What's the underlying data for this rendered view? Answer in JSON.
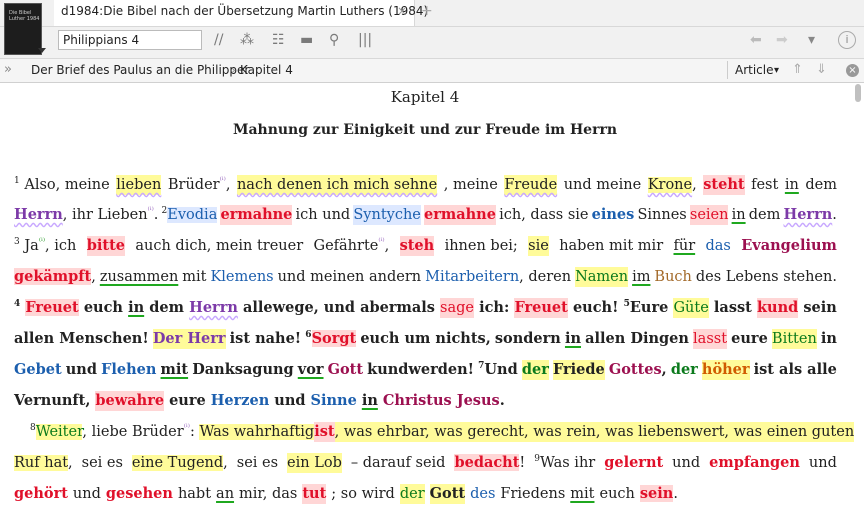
{
  "tab": {
    "title": "d1984:Die Bibel nach der Übersetzung Martin Luthers (1984)",
    "close_icon": "×",
    "add_icon": "+"
  },
  "toolbar": {
    "reference_value": "Philippians 4",
    "icons": [
      "parallel-icon",
      "group-icon",
      "list-icon",
      "panel-icon",
      "search-icon",
      "columns-icon"
    ],
    "nav": {
      "back": "⬅",
      "forward": "➡",
      "menu": "▾",
      "info": "i"
    }
  },
  "crumb": {
    "expand": "»",
    "book": "Der Brief des Paulus an die Philipper",
    "sep": "›",
    "chapter": "Kapitel 4",
    "view": "Article",
    "view_caret": "▾"
  },
  "content": {
    "chapter_title": "Kapitel 4",
    "heading": "Mahnung zur Einigkeit und zur Freude im Herrn",
    "line1": [
      "1",
      "Also, meine",
      "lieben",
      "Brüder",
      ",",
      "nach denen ich mich sehne",
      ", meine",
      "Freude",
      "und meine",
      "Krone",
      ",",
      "steht",
      "fest",
      "in",
      "dem"
    ],
    "line2": [
      "Herrn",
      ", ihr Lieben",
      ".",
      "2",
      "Evodia",
      "ermahne",
      "ich und",
      "Syntyche",
      "ermahne",
      "ich, dass sie",
      "eines",
      "Sinnes",
      "seien",
      "in",
      "dem",
      "Herrn",
      "."
    ],
    "line3": [
      "3",
      "Ja",
      ", ich",
      "bitte",
      "auch dich, mein treuer",
      "Gefährte",
      ",",
      "steh",
      "ihnen bei;",
      "sie",
      "haben mit mir",
      "für",
      "das",
      "Evangelium"
    ],
    "line4": [
      "gekämpft",
      ",",
      "zusammen",
      "mit",
      "Klemens",
      "und meinen andern",
      "Mitarbeitern",
      ", deren",
      "Namen",
      "im",
      "Buch",
      "des Lebens stehen."
    ],
    "line5": [
      "4",
      "Freuet",
      "euch",
      "in",
      "dem",
      "Herrn",
      "allewege, und abermals",
      "sage",
      "ich:",
      "Freuet",
      "euch!",
      "5",
      "Eure",
      "Güte",
      "lasst",
      "kund",
      "sein"
    ],
    "line6": [
      "allen Menschen!",
      "Der Herr",
      "ist nahe!",
      "6",
      "Sorgt",
      "euch um nichts,",
      "sondern",
      "in",
      "allen Dingen",
      "lasst",
      "eure",
      "Bitten",
      "in"
    ],
    "line7": [
      "Gebet",
      "und",
      "Flehen",
      "mit",
      "Danksagung",
      "vor",
      "Gott",
      "kundwerden!",
      "7",
      "Und",
      "der",
      "Friede",
      "Gottes",
      ",",
      "der",
      "höher",
      "ist als alle"
    ],
    "line8": [
      "Vernunft,",
      "bewahre",
      "eure",
      "Herzen",
      "und",
      "Sinne",
      "in",
      "Christus Jesus",
      "."
    ],
    "line9": [
      "8",
      "Weiter",
      ", liebe Brüder",
      ":",
      "Was wahrhaftig",
      "ist",
      ", was ehrbar, was gerecht, was rein, was liebenswert, was einen guten"
    ],
    "line10": [
      "Ruf hat",
      ",",
      "sei es",
      "eine Tugend",
      ",",
      "sei es",
      "ein Lob",
      "– darauf seid",
      "bedacht",
      "!",
      "9",
      "Was ihr",
      "gelernt",
      "und",
      "empfangen",
      "und"
    ],
    "line11": [
      "gehört",
      "und",
      "gesehen",
      "habt",
      "an",
      "mir, das",
      "tut",
      "; so wird",
      "der",
      "Gott",
      "des",
      "Friedens",
      "mit",
      "euch",
      "sein",
      "."
    ]
  }
}
